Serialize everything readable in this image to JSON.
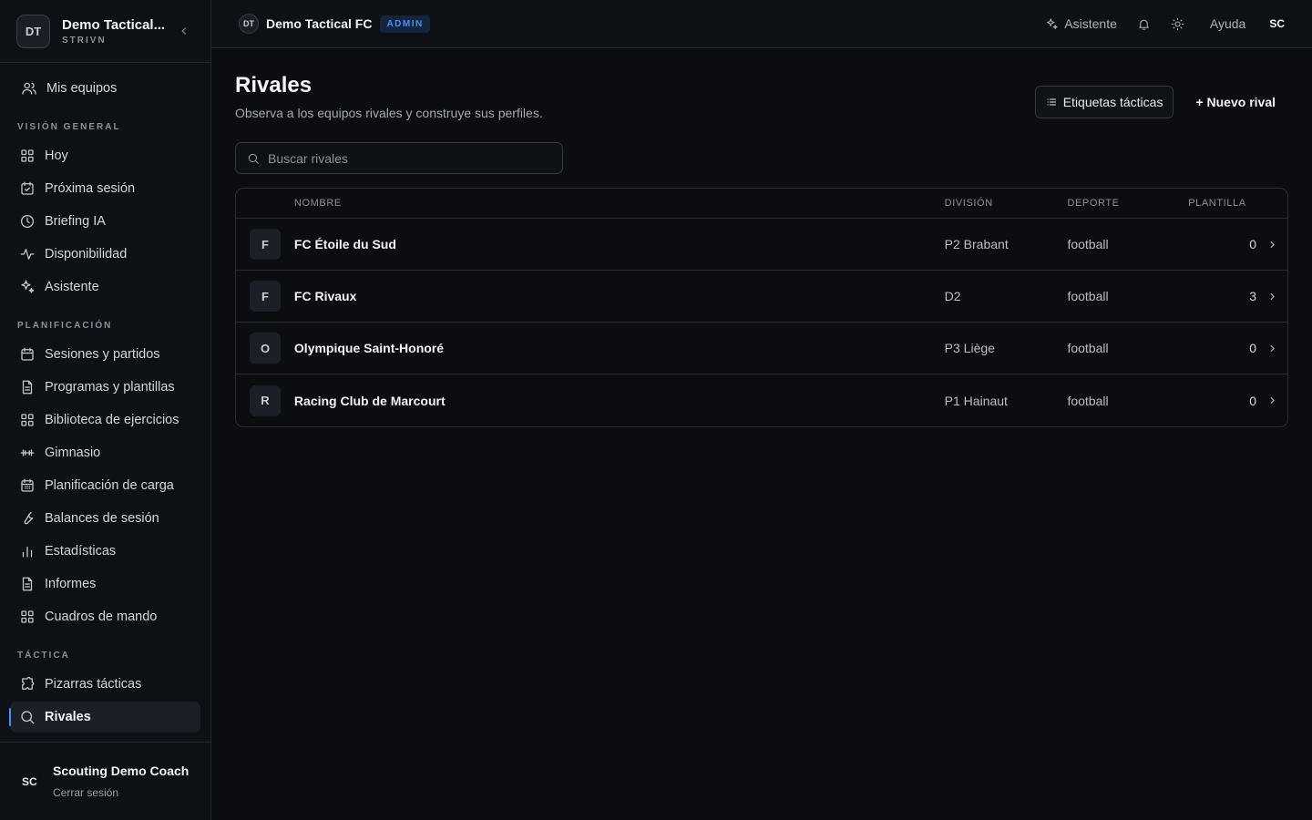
{
  "sidebar": {
    "team_initials": "DT",
    "team_name": "Demo Tactical...",
    "team_sub": "STRIVN",
    "top_item": "Mis equipos",
    "sections": [
      {
        "title": "VISIÓN GENERAL",
        "items": [
          {
            "label": "Hoy",
            "icon": "grid-icon"
          },
          {
            "label": "Próxima sesión",
            "icon": "calendar-check-icon"
          },
          {
            "label": "Briefing IA",
            "icon": "clock-icon"
          },
          {
            "label": "Disponibilidad",
            "icon": "activity-icon"
          },
          {
            "label": "Asistente",
            "icon": "sparkles-icon"
          }
        ]
      },
      {
        "title": "PLANIFICACIÓN",
        "items": [
          {
            "label": "Sesiones y partidos",
            "icon": "calendar-icon"
          },
          {
            "label": "Programas y plantillas",
            "icon": "document-icon"
          },
          {
            "label": "Biblioteca de ejercicios",
            "icon": "grid-icon"
          },
          {
            "label": "Gimnasio",
            "icon": "dumbbell-icon"
          },
          {
            "label": "Planificación de carga",
            "icon": "calendar-grid-icon"
          },
          {
            "label": "Balances de sesión",
            "icon": "wrench-icon"
          },
          {
            "label": "Estadísticas",
            "icon": "bar-chart-icon"
          },
          {
            "label": "Informes",
            "icon": "document-icon"
          },
          {
            "label": "Cuadros de mando",
            "icon": "grid-icon"
          }
        ]
      },
      {
        "title": "TÁCTICA",
        "items": [
          {
            "label": "Pizarras tácticas",
            "icon": "puzzle-icon"
          },
          {
            "label": "Rivales",
            "icon": "search-icon",
            "active": true
          }
        ]
      }
    ],
    "user_initials": "SC",
    "user_name": "Scouting Demo Coach",
    "logout": "Cerrar sesión"
  },
  "topbar": {
    "team_initials": "DT",
    "team_name": "Demo Tactical FC",
    "badge": "ADMIN",
    "assistant": "Asistente",
    "help": "Ayuda",
    "user_initials": "SC"
  },
  "main": {
    "title": "Rivales",
    "subtitle": "Observa a los equipos rivales y construye sus perfiles.",
    "tags_button": "Etiquetas tácticas",
    "new_button": "+ Nuevo rival",
    "search_placeholder": "Buscar rivales",
    "columns": {
      "name": "NOMBRE",
      "division": "DIVISIÓN",
      "sport": "DEPORTE",
      "squad": "PLANTILLA"
    },
    "rows": [
      {
        "initial": "F",
        "name": "FC Étoile du Sud",
        "division": "P2 Brabant",
        "sport": "football",
        "squad": "0"
      },
      {
        "initial": "F",
        "name": "FC Rivaux",
        "division": "D2",
        "sport": "football",
        "squad": "3"
      },
      {
        "initial": "O",
        "name": "Olympique Saint-Honoré",
        "division": "P3 Liège",
        "sport": "football",
        "squad": "0"
      },
      {
        "initial": "R",
        "name": "Racing Club de Marcourt",
        "division": "P1 Hainaut",
        "sport": "football",
        "squad": "0"
      }
    ]
  }
}
